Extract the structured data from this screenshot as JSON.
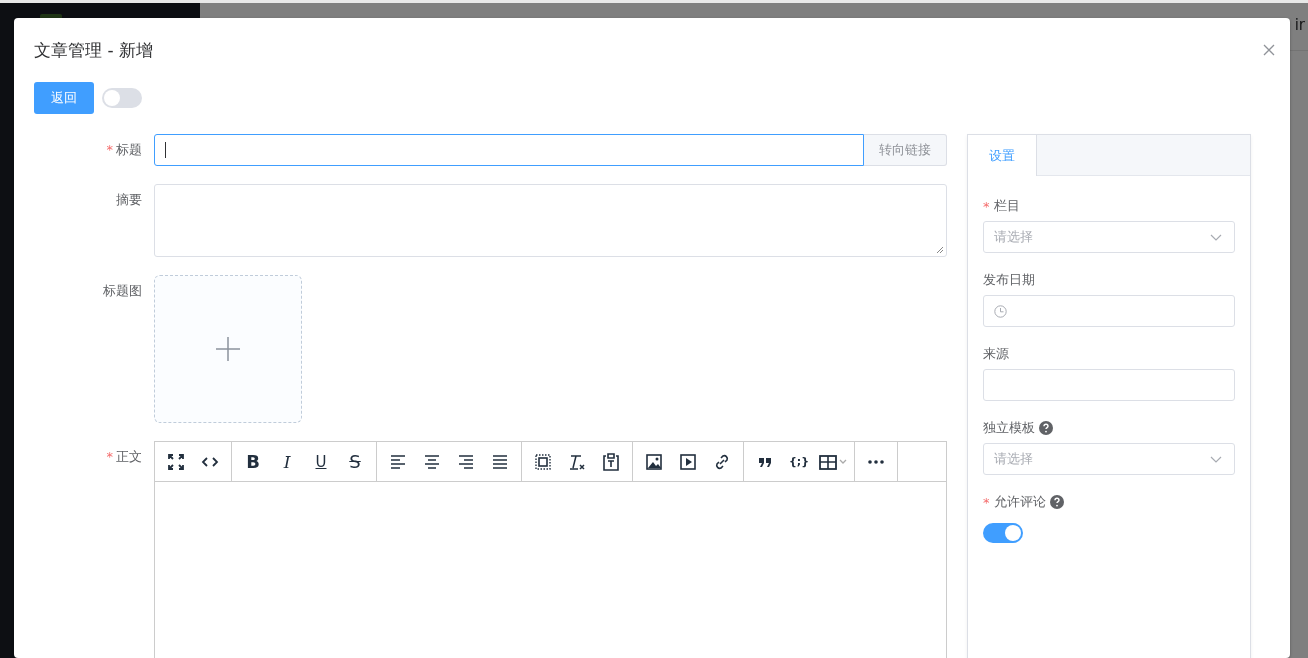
{
  "background": {
    "header_text": "ir"
  },
  "dialog": {
    "title": "文章管理 - 新增",
    "back_button": "返回",
    "mode_switch": {
      "on": false
    }
  },
  "form": {
    "fields": [
      {
        "kind": "input",
        "label": "标题",
        "required_mark": "*",
        "focused": true,
        "append": "转向链接"
      },
      {
        "kind": "textarea",
        "label": "摘要"
      },
      {
        "kind": "upload",
        "label": "标题图"
      },
      {
        "kind": "editor",
        "label": "正文",
        "required_mark": "*"
      }
    ]
  },
  "toolbar": [
    [
      {
        "kind": "fullscreen"
      },
      {
        "kind": "code"
      }
    ],
    [
      {
        "kind": "bold",
        "text": "B"
      },
      {
        "kind": "italic",
        "text": "I"
      },
      {
        "kind": "underline",
        "text": "U"
      },
      {
        "kind": "strike",
        "text": "S"
      }
    ],
    [
      {
        "kind": "align-left"
      },
      {
        "kind": "align-center"
      },
      {
        "kind": "align-right"
      },
      {
        "kind": "justify"
      }
    ],
    [
      {
        "kind": "select-all"
      },
      {
        "kind": "clear-format"
      },
      {
        "kind": "paste-text"
      }
    ],
    [
      {
        "kind": "image"
      },
      {
        "kind": "video"
      },
      {
        "kind": "link"
      }
    ],
    [
      {
        "kind": "quote"
      },
      {
        "kind": "code-block",
        "text": "{;}"
      },
      {
        "kind": "table"
      }
    ],
    [
      {
        "kind": "more"
      }
    ]
  ],
  "settings": {
    "tabs": [
      {
        "label": "设置",
        "selected": true
      }
    ],
    "fields": [
      {
        "kind": "select",
        "label": "栏目",
        "required_mark": "*",
        "placeholder": "请选择"
      },
      {
        "kind": "date",
        "label": "发布日期"
      },
      {
        "kind": "input",
        "label": "来源"
      },
      {
        "kind": "select",
        "label": "独立模板",
        "help": true,
        "placeholder": "请选择"
      },
      {
        "kind": "switch",
        "label": "允许评论",
        "required_mark": "*",
        "help": true,
        "on": true
      }
    ]
  }
}
